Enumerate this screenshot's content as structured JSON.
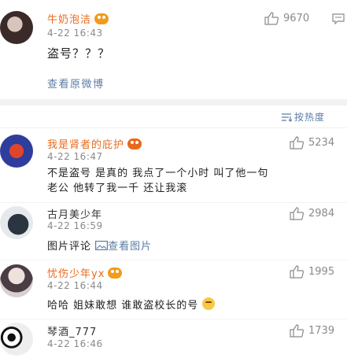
{
  "post": {
    "username": "牛奶泡洁",
    "time": "4-22 16:43",
    "likes": "9670",
    "content": "盗号？？？",
    "view_original": "查看原微博"
  },
  "sort": {
    "label": "按热度"
  },
  "comments": [
    {
      "username": "我是肾者的庇护",
      "time": "4-22 16:47",
      "likes": "5234",
      "line1": "不是盗号 是真的 我点了一个小时 叫了他一句",
      "line2": "老公 他转了我一千 还让我滚"
    },
    {
      "username": "古月美少年",
      "time": "4-22 16:59",
      "likes": "2984",
      "text": "图片评论",
      "view_image": "查看图片"
    },
    {
      "username": "忧伤少年yx",
      "time": "4-22 16:44",
      "likes": "1995",
      "text": "哈哈 姐妹敢想 谁敢盗校长的号"
    },
    {
      "username": "琴酒_777",
      "time": "4-22 16:46",
      "likes": "1739"
    }
  ],
  "icons": {
    "like": "thumbs-up-icon",
    "comment": "comment-icon",
    "sort": "sort-icon",
    "image": "image-icon",
    "vip": "vip-badge-icon",
    "emoji": "smile-emoji-icon"
  },
  "colors": {
    "vip_name": "#e8691c",
    "link": "#5b7ca3",
    "meta": "#8a8a8a",
    "separator": "#f2f2f2"
  }
}
